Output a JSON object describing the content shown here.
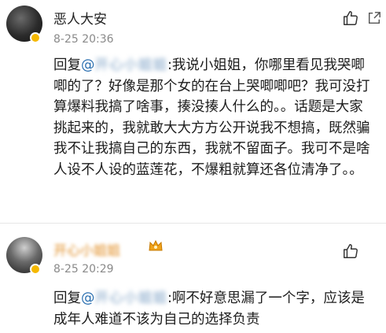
{
  "comments": [
    {
      "username": "恶人大安",
      "timestamp": "8-25 20:36",
      "reply_prefix": "回复",
      "mention": "@",
      "mention_name_blurred": "开心小姐姐",
      "body": ":我说小姐姐，你哪里看见我哭唧唧的了？好像是那个女的在台上哭唧唧吧？我可没打算爆料我搞了啥事，揍没揍人什么的。。话题是大家挑起来的，我就敢大大方方公开说我不想搞，既然骗我不让我搞自己的东西，我就不留面子。我可不是啥人设不人设的蓝莲花，不爆粗就算还各位清净了。。"
    },
    {
      "username_blurred": "开心小姐姐",
      "timestamp": "8-25 20:29",
      "reply_prefix": "回复",
      "mention": "@",
      "mention_name_blurred": "开心小姐姐",
      "body": ":啊不好意思漏了一个字，应该是成年人难道不该为自己的选择负责"
    }
  ],
  "icons": {
    "like": "thumbs-up-icon",
    "share": "share-icon",
    "vip": "vip-badge-icon",
    "crown": "crown-icon"
  },
  "colors": {
    "mention": "#2a6fb0",
    "vip_name": "#e08a1e",
    "timestamp": "#8a8a8a",
    "vip_badge": "#f5b800"
  }
}
